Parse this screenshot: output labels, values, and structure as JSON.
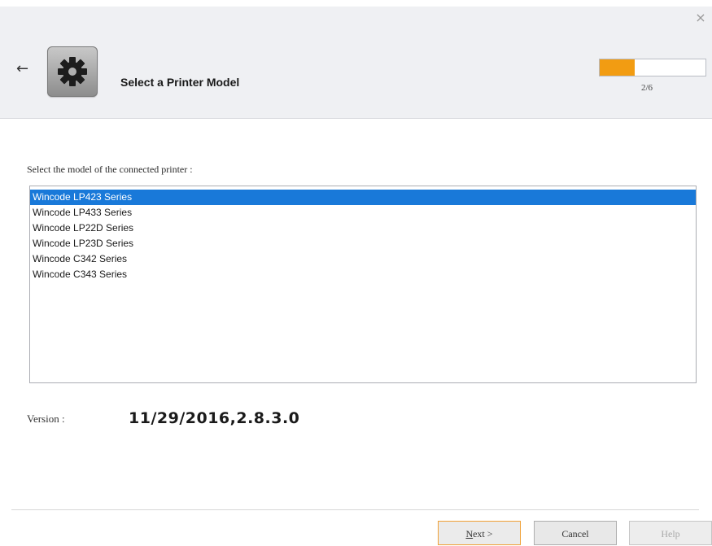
{
  "window": {
    "close_glyph": "×"
  },
  "header": {
    "back_glyph": "←",
    "icon": "gear-icon",
    "title": "Select a Printer Model",
    "progress": {
      "current": 2,
      "total": 6,
      "label": "2/6",
      "fill_color": "#f29c12"
    }
  },
  "main": {
    "prompt": "Select the model of the connected printer :",
    "models": [
      {
        "label": "Wincode LP423 Series",
        "selected": true
      },
      {
        "label": "Wincode LP433 Series",
        "selected": false
      },
      {
        "label": "Wincode LP22D Series",
        "selected": false
      },
      {
        "label": "Wincode LP23D Series",
        "selected": false
      },
      {
        "label": "Wincode C342 Series",
        "selected": false
      },
      {
        "label": "Wincode C343 Series",
        "selected": false
      }
    ],
    "selection_color": "#1979d9",
    "version_label": "Version :",
    "version_value": "11/29/2016,2.8.3.0"
  },
  "footer": {
    "next_mnemonic": "N",
    "next_rest": "ext >",
    "cancel_label": "Cancel",
    "help_label": "Help"
  }
}
